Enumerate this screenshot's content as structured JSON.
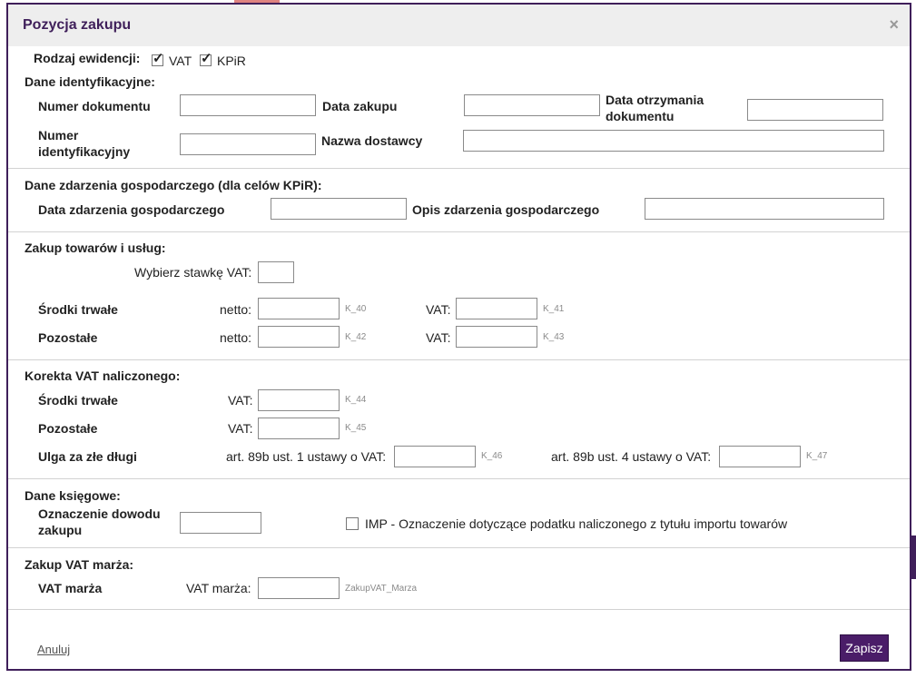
{
  "dialog": {
    "title": "Pozycja zakupu",
    "close": "×"
  },
  "rodzaj": {
    "label": "Rodzaj ewidencji:",
    "vat_label": "VAT",
    "vat_checked": true,
    "kpir_label": "KPiR",
    "kpir_checked": true
  },
  "identyfikacyjne": {
    "header": "Dane identyfikacyjne:",
    "numer_dokumentu": "Numer dokumentu",
    "data_zakupu": "Data zakupu",
    "data_otrzymania_line1": "Data otrzymania",
    "data_otrzymania_line2": "dokumentu",
    "numer_ident_line1": "Numer",
    "numer_ident_line2": "identyfikacyjny",
    "nazwa_dostawcy": "Nazwa dostawcy"
  },
  "zdarzenie": {
    "header": "Dane zdarzenia gospodarczego (dla celów KPiR):",
    "data_label": "Data zdarzenia gospodarczego",
    "opis_label": "Opis zdarzenia gospodarczego"
  },
  "zakup": {
    "header": "Zakup towarów i usług:",
    "stawka_label": "Wybierz stawkę VAT:",
    "srodki_label": "Środki trwałe",
    "pozostale_label": "Pozostałe",
    "netto": "netto:",
    "vat": "VAT:",
    "codes": {
      "k40": "K_40",
      "k41": "K_41",
      "k42": "K_42",
      "k43": "K_43"
    }
  },
  "korekta": {
    "header": "Korekta VAT naliczonego:",
    "srodki_label": "Środki trwałe",
    "pozostale_label": "Pozostałe",
    "ulga_label": "Ulga za złe długi",
    "vat": "VAT:",
    "art1": "art. 89b ust. 1 ustawy o VAT:",
    "art4": "art. 89b ust. 4 ustawy o VAT:",
    "codes": {
      "k44": "K_44",
      "k45": "K_45",
      "k46": "K_46",
      "k47": "K_47"
    }
  },
  "ksiegowe": {
    "header": "Dane księgowe:",
    "oznaczenie_line1": "Oznaczenie dowodu",
    "oznaczenie_line2": "zakupu",
    "imp_label": "IMP - Oznaczenie dotyczące podatku naliczonego z tytułu importu towarów",
    "imp_checked": false
  },
  "marza": {
    "header": "Zakup VAT marża:",
    "label": "VAT marża",
    "field_label": "VAT marża:",
    "code": "ZakupVAT_Marza"
  },
  "footer": {
    "cancel": "Anuluj",
    "save": "Zapisz"
  }
}
